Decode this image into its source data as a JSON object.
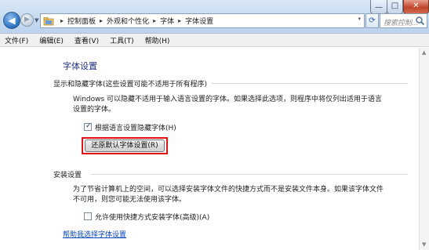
{
  "window": {
    "min_glyph": "—",
    "max_glyph": "□",
    "close_glyph": "✕"
  },
  "address_bar": {
    "segments": [
      "控制面板",
      "外观和个性化",
      "字体",
      "字体设置"
    ],
    "separator": "▸",
    "dropdown": "▾"
  },
  "search": {
    "placeholder": "搜索控制..."
  },
  "menubar": {
    "items": [
      "文件(F)",
      "编辑(E)",
      "查看(V)",
      "工具(T)",
      "帮助(H)"
    ]
  },
  "page": {
    "title": "字体设置",
    "section1": {
      "heading": "显示和隐藏字体(这些设置可能不适用于所有程序)",
      "description_line1": "Windows 可以隐藏不适用于输入语言设置的字体。如果选择此选项，则程序中将仅列出适用于语言",
      "description_line2": "设置的字体。",
      "checkbox_label": "根据语言设置隐藏字体(H)",
      "checkbox_checked": true,
      "button_label": "还原默认字体设置(R)"
    },
    "section2": {
      "heading": "安装设置",
      "description_line1": "为了节省计算机上的空间，可以选择安装字体文件的快捷方式而不是安装文件本身。如果该字体文件",
      "description_line2": "不可用，则您可能无法使用该字体。",
      "checkbox_label": "允许使用快捷方式安装字体(高级)(A)",
      "checkbox_checked": false
    },
    "help_link": "帮助我选择字体设置"
  },
  "colors": {
    "title": "#1e3287",
    "link": "#0a47b8",
    "highlight": "#e01414"
  }
}
